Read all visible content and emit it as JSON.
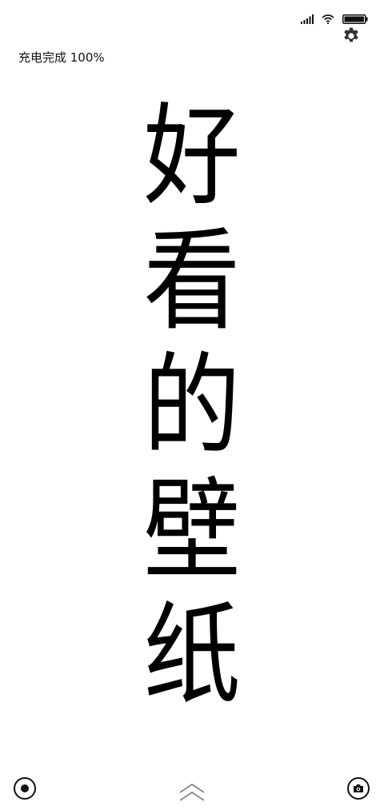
{
  "status_bar": {
    "signal_icon": "signal-icon",
    "wifi_icon": "wifi-icon",
    "battery_icon": "battery-icon",
    "battery_level": 1.0
  },
  "settings": {
    "icon": "gear-icon"
  },
  "charging": {
    "text": "充电完成 100%"
  },
  "wallpaper_text": {
    "chars": [
      "好",
      "看",
      "的",
      "壁",
      "纸"
    ]
  },
  "bottom": {
    "left_icon": "record-icon",
    "center_icon": "unlock-chevron-icon",
    "right_icon": "camera-icon"
  }
}
